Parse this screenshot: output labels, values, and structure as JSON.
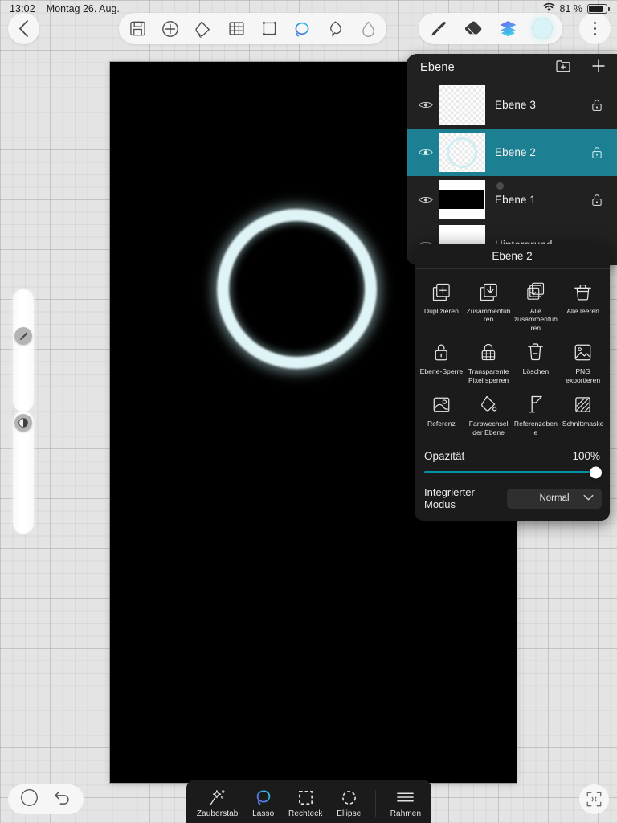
{
  "status_bar": {
    "time": "13:02",
    "date": "Montag 26. Aug.",
    "wifi_icon": "wifi-icon",
    "battery_percent": "81 %",
    "battery_level": 81
  },
  "top_toolbar": {
    "back_icon": "chevron-left-icon",
    "tools": [
      {
        "name": "save-icon",
        "label": "Speichern",
        "active": false
      },
      {
        "name": "add-icon",
        "label": "Hinzufügen",
        "active": false
      },
      {
        "name": "paint-bucket-icon",
        "label": "Füllen",
        "active": false
      },
      {
        "name": "grid-icon",
        "label": "Raster",
        "active": false
      },
      {
        "name": "transform-frame-icon",
        "label": "Transformieren",
        "active": false
      },
      {
        "name": "lasso-select-icon",
        "label": "Auswahl",
        "active": true
      },
      {
        "name": "smudge-icon",
        "label": "Verwischen",
        "active": false
      },
      {
        "name": "blur-drop-icon",
        "label": "Weichzeichnen",
        "active": false
      }
    ],
    "right_tools": [
      {
        "name": "brush-icon",
        "label": "Pinsel",
        "active": false
      },
      {
        "name": "eraser-icon",
        "label": "Radierer",
        "active": false
      },
      {
        "name": "layers-icon",
        "label": "Ebenen",
        "active": true
      },
      {
        "name": "color-swatch",
        "label": "Farbe",
        "color": "#d9f3f6"
      }
    ],
    "more_icon": "more-vertical-icon"
  },
  "left_sliders": [
    {
      "name": "brush-size-slider",
      "handle_icon": "pencil-icon",
      "value": 31
    },
    {
      "name": "brush-opacity-slider",
      "handle_icon": "opacity-icon",
      "value": 2
    }
  ],
  "canvas": {
    "background_color": "#000000",
    "shape": "glowing-ring",
    "shape_color": "#dff4f6"
  },
  "layers_panel": {
    "title": "Ebene",
    "new_folder_icon": "new-folder-icon",
    "add_layer_icon": "plus-icon",
    "layers": [
      {
        "name": "Ebene 3",
        "visible": true,
        "locked": false,
        "selected": false,
        "thumb": "checker"
      },
      {
        "name": "Ebene 2",
        "visible": true,
        "locked": false,
        "selected": true,
        "thumb": "checker-ring"
      },
      {
        "name": "Ebene 1",
        "visible": true,
        "locked": false,
        "selected": false,
        "thumb": "stripes",
        "has_mask_dot": true
      },
      {
        "name": "Hintergrund",
        "visible": false,
        "locked": false,
        "selected": false,
        "thumb": "white"
      }
    ]
  },
  "context_menu": {
    "title": "Ebene 2",
    "actions": [
      {
        "label": "Duplizieren",
        "icon": "duplicate-layer-icon"
      },
      {
        "label": "Zusammenführen",
        "icon": "merge-down-icon"
      },
      {
        "label": "Alle zusammenführen",
        "icon": "merge-all-icon"
      },
      {
        "label": "Alle leeren",
        "icon": "clear-all-icon"
      },
      {
        "label": "Ebene-Sperre",
        "icon": "lock-layer-icon"
      },
      {
        "label": "Transparente Pixel sperren",
        "icon": "lock-transparent-pixels-icon"
      },
      {
        "label": "Löschen",
        "icon": "delete-icon"
      },
      {
        "label": "PNG exportieren",
        "icon": "export-png-icon"
      },
      {
        "label": "Referenz",
        "icon": "reference-icon"
      },
      {
        "label": "Farbwechsel der Ebene",
        "icon": "layer-color-change-icon"
      },
      {
        "label": "Referenzebene",
        "icon": "reference-layer-flag-icon"
      },
      {
        "label": "Schnittmaske",
        "icon": "clipping-mask-icon"
      }
    ],
    "opacity_label": "Opazität",
    "opacity_value": "100%",
    "opacity_percent": 100,
    "blend_label": "Integrierter Modus",
    "blend_value": "Normal",
    "blend_chevron_icon": "chevron-down-icon",
    "accent_color": "#0093a8"
  },
  "bottom_left": {
    "circle_icon": "circle-icon",
    "undo_icon": "undo-icon"
  },
  "selection_bar": {
    "items": [
      {
        "label": "Zauberstab",
        "icon": "magic-wand-icon",
        "active": false
      },
      {
        "label": "Lasso",
        "icon": "lasso-icon",
        "active": true
      },
      {
        "label": "Rechteck",
        "icon": "rectangle-select-icon",
        "active": false
      },
      {
        "label": "Ellipse",
        "icon": "ellipse-select-icon",
        "active": false
      },
      {
        "label": "Rahmen",
        "icon": "menu-lines-icon",
        "active": false
      }
    ]
  },
  "fit_button": {
    "icon": "fit-screen-icon"
  },
  "colors": {
    "selected_layer": "#1c7f92",
    "panel_background": "#212121",
    "menu_background": "#1b1b1b",
    "accent": "#0093a8"
  }
}
